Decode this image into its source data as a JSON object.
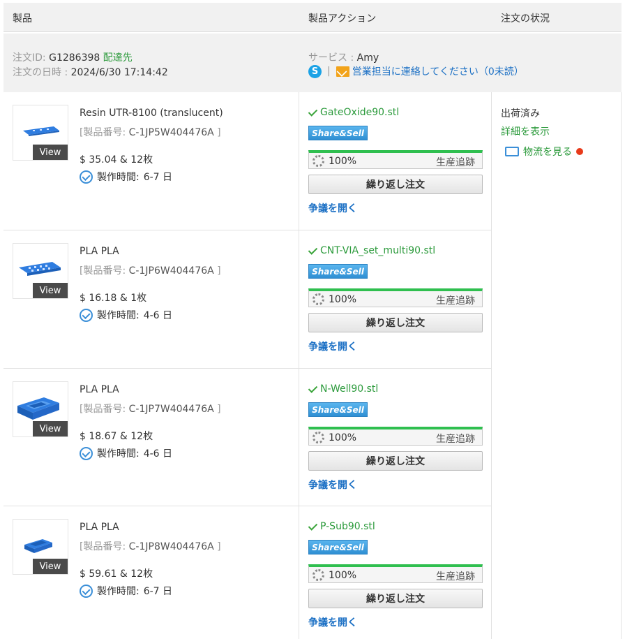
{
  "header": {
    "col_product": "製品",
    "col_action": "製品アクション",
    "col_status": "注文の状況"
  },
  "order": {
    "id_label": "注文ID:",
    "id_value": "G1286398",
    "ship_link": "配達先",
    "date_label": "注文の日時 :",
    "date_value": "2024/6/30 17:14:42",
    "service_label": "サービス :",
    "service_value": "Amy",
    "separator": "|",
    "contact_text": "営業担当に連絡してください（0未読）"
  },
  "status": {
    "state": "出荷済み",
    "details_link": "詳細を表示",
    "logistics_link": "物流を見る"
  },
  "common": {
    "view_label": "View",
    "code_label": "[製品番号:",
    "code_close": "]",
    "time_label": "製作時間:",
    "share_label": "Share&Sell",
    "track_label": "生産追跡",
    "reorder_label": "繰り返し注文",
    "dispute_label": "争議を開く"
  },
  "items": [
    {
      "name": "Resin UTR-8100 (translucent)",
      "code": "C-1JP5W404476A",
      "price": "$ 35.04 & 12枚",
      "time": "6-7 日",
      "file": "GateOxide90.stl",
      "progress": "100%"
    },
    {
      "name": "PLA PLA",
      "code": "C-1JP6W404476A",
      "price": "$ 16.18 & 1枚",
      "time": "4-6 日",
      "file": "CNT-VIA_set_multi90.stl",
      "progress": "100%"
    },
    {
      "name": "PLA PLA",
      "code": "C-1JP7W404476A",
      "price": "$ 18.67 & 12枚",
      "time": "4-6 日",
      "file": "N-Well90.stl",
      "progress": "100%"
    },
    {
      "name": "PLA PLA",
      "code": "C-1JP8W404476A",
      "price": "$ 59.61 & 12枚",
      "time": "6-7 日",
      "file": "P-Sub90.stl",
      "progress": "100%"
    }
  ],
  "colors": {
    "accent_green": "#2b9a3b",
    "link_blue": "#1a6fc4",
    "progress_green": "#2fbf4f",
    "model_blue": "#2f7de0"
  },
  "icons": [
    "skype-icon",
    "mail-icon",
    "clock-icon",
    "check-icon",
    "gear-icon",
    "truck-icon"
  ]
}
